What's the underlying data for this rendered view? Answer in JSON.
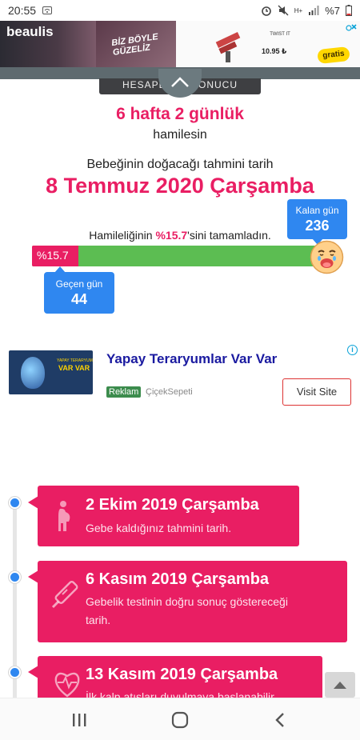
{
  "status_bar": {
    "time": "20:55",
    "battery": "%7",
    "network_indicator": "H+"
  },
  "ad_banner": {
    "brand": "beaulis",
    "slogan_line1": "BİZ BÖYLE",
    "slogan_line2": "GÜZELİZ",
    "product_name": "TWIST IT",
    "price": "10.95 ₺",
    "badge": "gratis",
    "close_icon": "close-icon"
  },
  "result_tab": {
    "label": "HESAPLAMA SONUCU"
  },
  "summary": {
    "weeks_days": "6 hafta 2 günlük",
    "pregnant_text": "hamilesin",
    "due_label": "Bebeğinin doğacağı tahmini tarih",
    "due_date": "8 Temmuz 2020 Çarşamba"
  },
  "progress": {
    "prefix": "Hamileliğinin ",
    "percent_text": "%15.7",
    "suffix": "'sini tamamladın.",
    "bar_label": "%15.7",
    "fraction": 0.157,
    "remaining_label": "Kalan gün",
    "remaining_days": "236",
    "passed_label": "Geçen gün",
    "passed_days": "44"
  },
  "native_ad": {
    "title": "Yapay Teraryumlar Var Var",
    "image_small_text": "YAPAY TERARYUM",
    "image_big_text": "VAR VAR",
    "badge": "Reklam",
    "advertiser": "ÇiçekSepeti",
    "cta": "Visit Site"
  },
  "timeline": [
    {
      "date": "2 Ekim 2019 Çarşamba",
      "description": "Gebe kaldığınız tahmini tarih.",
      "icon": "pregnant-woman-icon"
    },
    {
      "date": "6 Kasım 2019 Çarşamba",
      "description_line1": "Gebelik testinin doğru sonuç göstereceği",
      "description_line2": "tarih.",
      "icon": "pregnancy-test-icon"
    },
    {
      "date": "13 Kasım 2019 Çarşamba",
      "description": "İlk kalp atışları duyulmaya başlanabilir",
      "icon": "heartbeat-icon"
    }
  ],
  "colors": {
    "accent": "#e91e63",
    "info_blue": "#2f87f0",
    "progress_green": "#5cbd52"
  }
}
